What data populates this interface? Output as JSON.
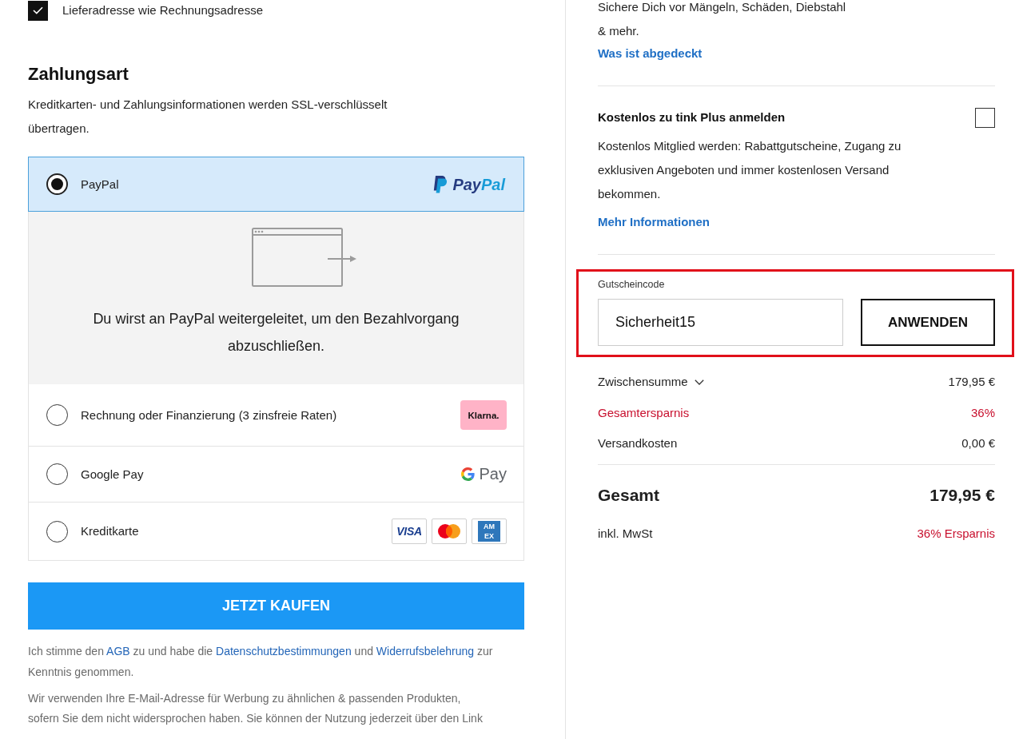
{
  "shipping_same_as_billing": {
    "label": "Lieferadresse wie Rechnungsadresse",
    "checked": true
  },
  "payment": {
    "title": "Zahlungsart",
    "note": "Kreditkarten- und Zahlungsinformationen werden SSL-verschlüsselt übertragen.",
    "methods": [
      {
        "kind": "paypal",
        "label": "PayPal",
        "selected": true,
        "logo": "PayPal",
        "redirect_text": "Du wirst an PayPal weitergeleitet, um den Bezahlvorgang abzuschließen."
      },
      {
        "kind": "klarna",
        "label": "Rechnung oder Finanzierung (3 zinsfreie Raten)",
        "selected": false,
        "logo": "Klarna."
      },
      {
        "kind": "googlepay",
        "label": "Google Pay",
        "selected": false,
        "logo": "Pay"
      },
      {
        "kind": "cards",
        "label": "Kreditkarte",
        "selected": false,
        "cards": [
          {
            "kind": "visa",
            "text": "VISA"
          },
          {
            "kind": "mastercard"
          },
          {
            "kind": "amex",
            "text": "AM EX"
          }
        ]
      }
    ]
  },
  "buy_button": "JETZT KAUFEN",
  "consent": [
    {
      "kind": "text",
      "text": "Ich stimme den "
    },
    {
      "kind": "link",
      "text": "AGB"
    },
    {
      "kind": "text",
      "text": " zu und habe die "
    },
    {
      "kind": "link",
      "text": "Datenschutzbestimmungen"
    },
    {
      "kind": "text",
      "text": " und "
    },
    {
      "kind": "link",
      "text": "Widerrufsbelehrung"
    },
    {
      "kind": "text",
      "text": " zur Kenntnis genommen."
    }
  ],
  "marketing_note": "Wir verwenden Ihre E-Mail-Adresse für Werbung zu ähnlichen & passenden Produkten, sofern Sie dem nicht widersprochen haben. Sie können der Nutzung jederzeit über den Link",
  "protection": {
    "text": "Sichere Dich vor Mängeln, Schäden, Diebstahl & mehr.",
    "link": "Was ist abgedeckt"
  },
  "membership": {
    "title": "Kostenlos zu tink Plus anmelden",
    "checked": false,
    "text": "Kostenlos Mitglied werden: Rabattgutscheine, Zugang zu exklusiven Angeboten und immer kostenlosen Versand bekommen.",
    "link": "Mehr Informationen"
  },
  "voucher": {
    "highlighted": true,
    "label": "Gutscheincode",
    "value": "Sicherheit15",
    "button": "ANWENDEN"
  },
  "summary": [
    {
      "kind": "toggle",
      "label": "Zwischensumme",
      "value": "179,95 €"
    },
    {
      "kind": "savings",
      "label": "Gesamtersparnis",
      "value": "36%"
    },
    {
      "kind": "plain",
      "label": "Versandkosten",
      "value": "0,00 €"
    }
  ],
  "total": {
    "label": "Gesamt",
    "value": "179,95 €"
  },
  "tax": {
    "label": "inkl. MwSt",
    "savings": "36% Ersparnis"
  }
}
